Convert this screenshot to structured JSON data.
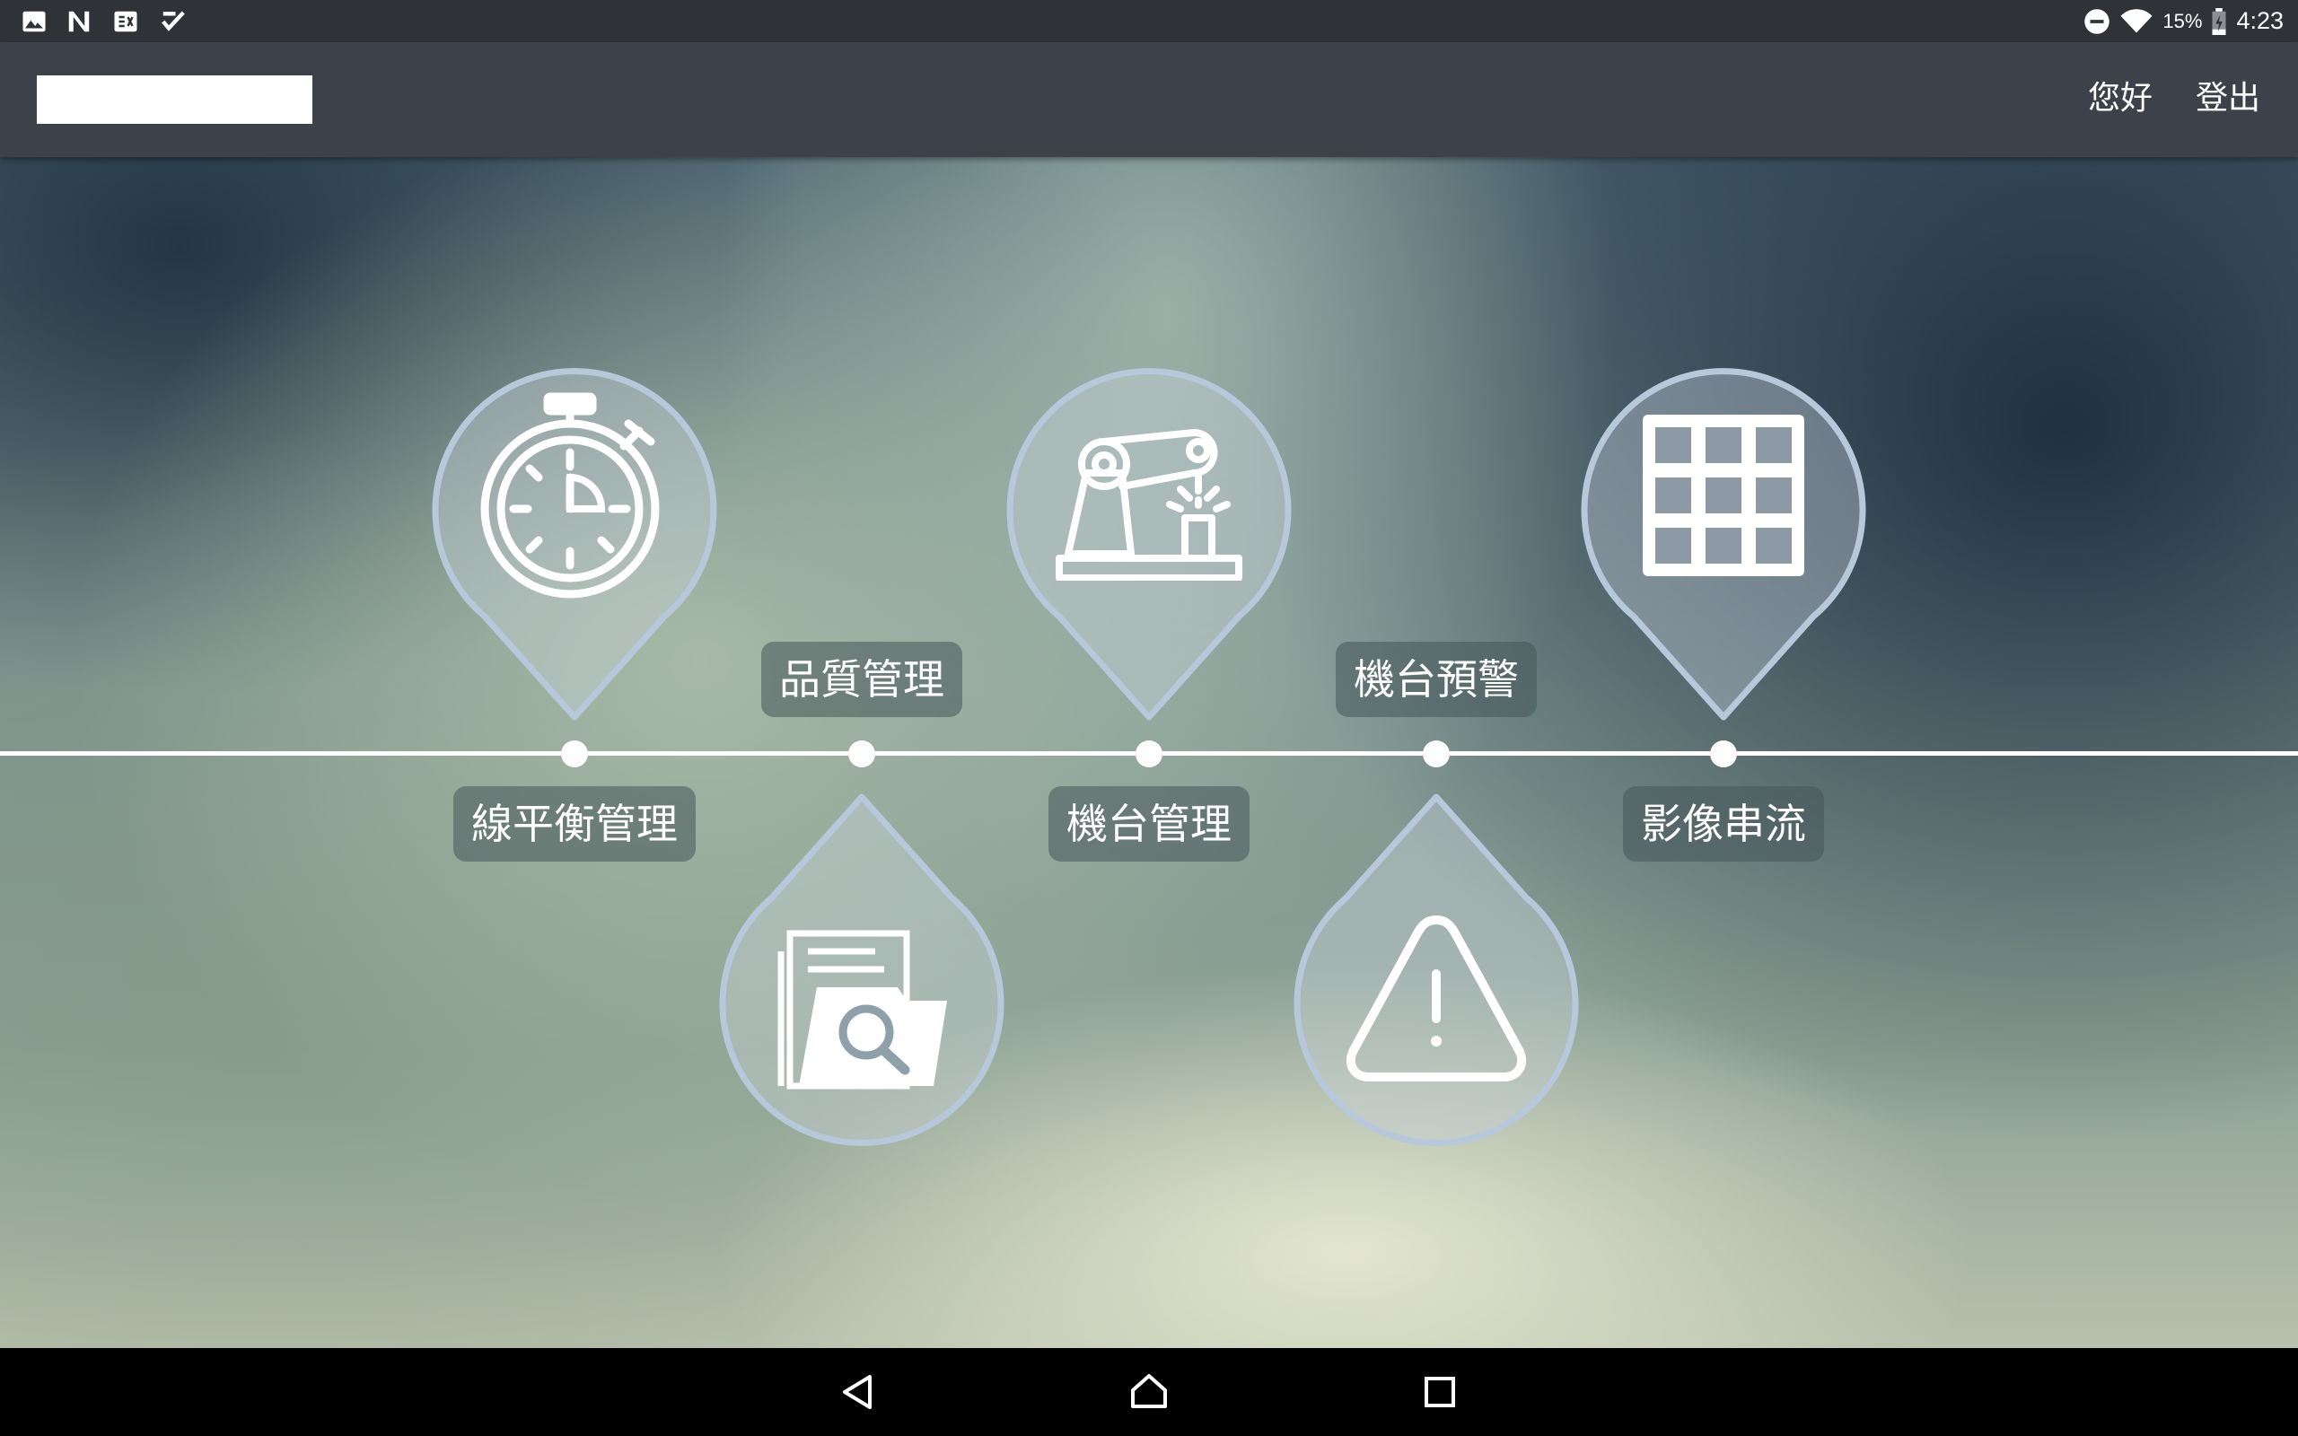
{
  "status_bar": {
    "left_icons": [
      "gallery-icon",
      "n-app-icon",
      "news-app-icon",
      "task-app-icon"
    ],
    "dnd_icon": "do-not-disturb-icon",
    "wifi_icon": "wifi-icon",
    "battery_percent": "15%",
    "battery_icon": "battery-charging-icon",
    "time": "4:23"
  },
  "app_bar": {
    "greeting": "您好",
    "logout": "登出"
  },
  "menu": {
    "items": [
      {
        "label": "線平衡管理",
        "icon": "stopwatch-icon",
        "position": "top"
      },
      {
        "label": "品質管理",
        "icon": "document-search-icon",
        "position": "bottom"
      },
      {
        "label": "機台管理",
        "icon": "robot-arm-icon",
        "position": "top"
      },
      {
        "label": "機台預警",
        "icon": "warning-icon",
        "position": "bottom"
      },
      {
        "label": "影像串流",
        "icon": "grid-icon",
        "position": "top"
      }
    ]
  },
  "nav_bar": {
    "back_icon": "back-icon",
    "home_icon": "home-icon",
    "recents_icon": "recents-icon"
  },
  "colors": {
    "status_bar": "#2f3338",
    "app_bar": "#3d424a",
    "pin_fill": "rgba(190,200,210,0.45)",
    "pin_stroke": "#b7c8da",
    "label_bg": "rgba(70,85,90,0.55)"
  }
}
